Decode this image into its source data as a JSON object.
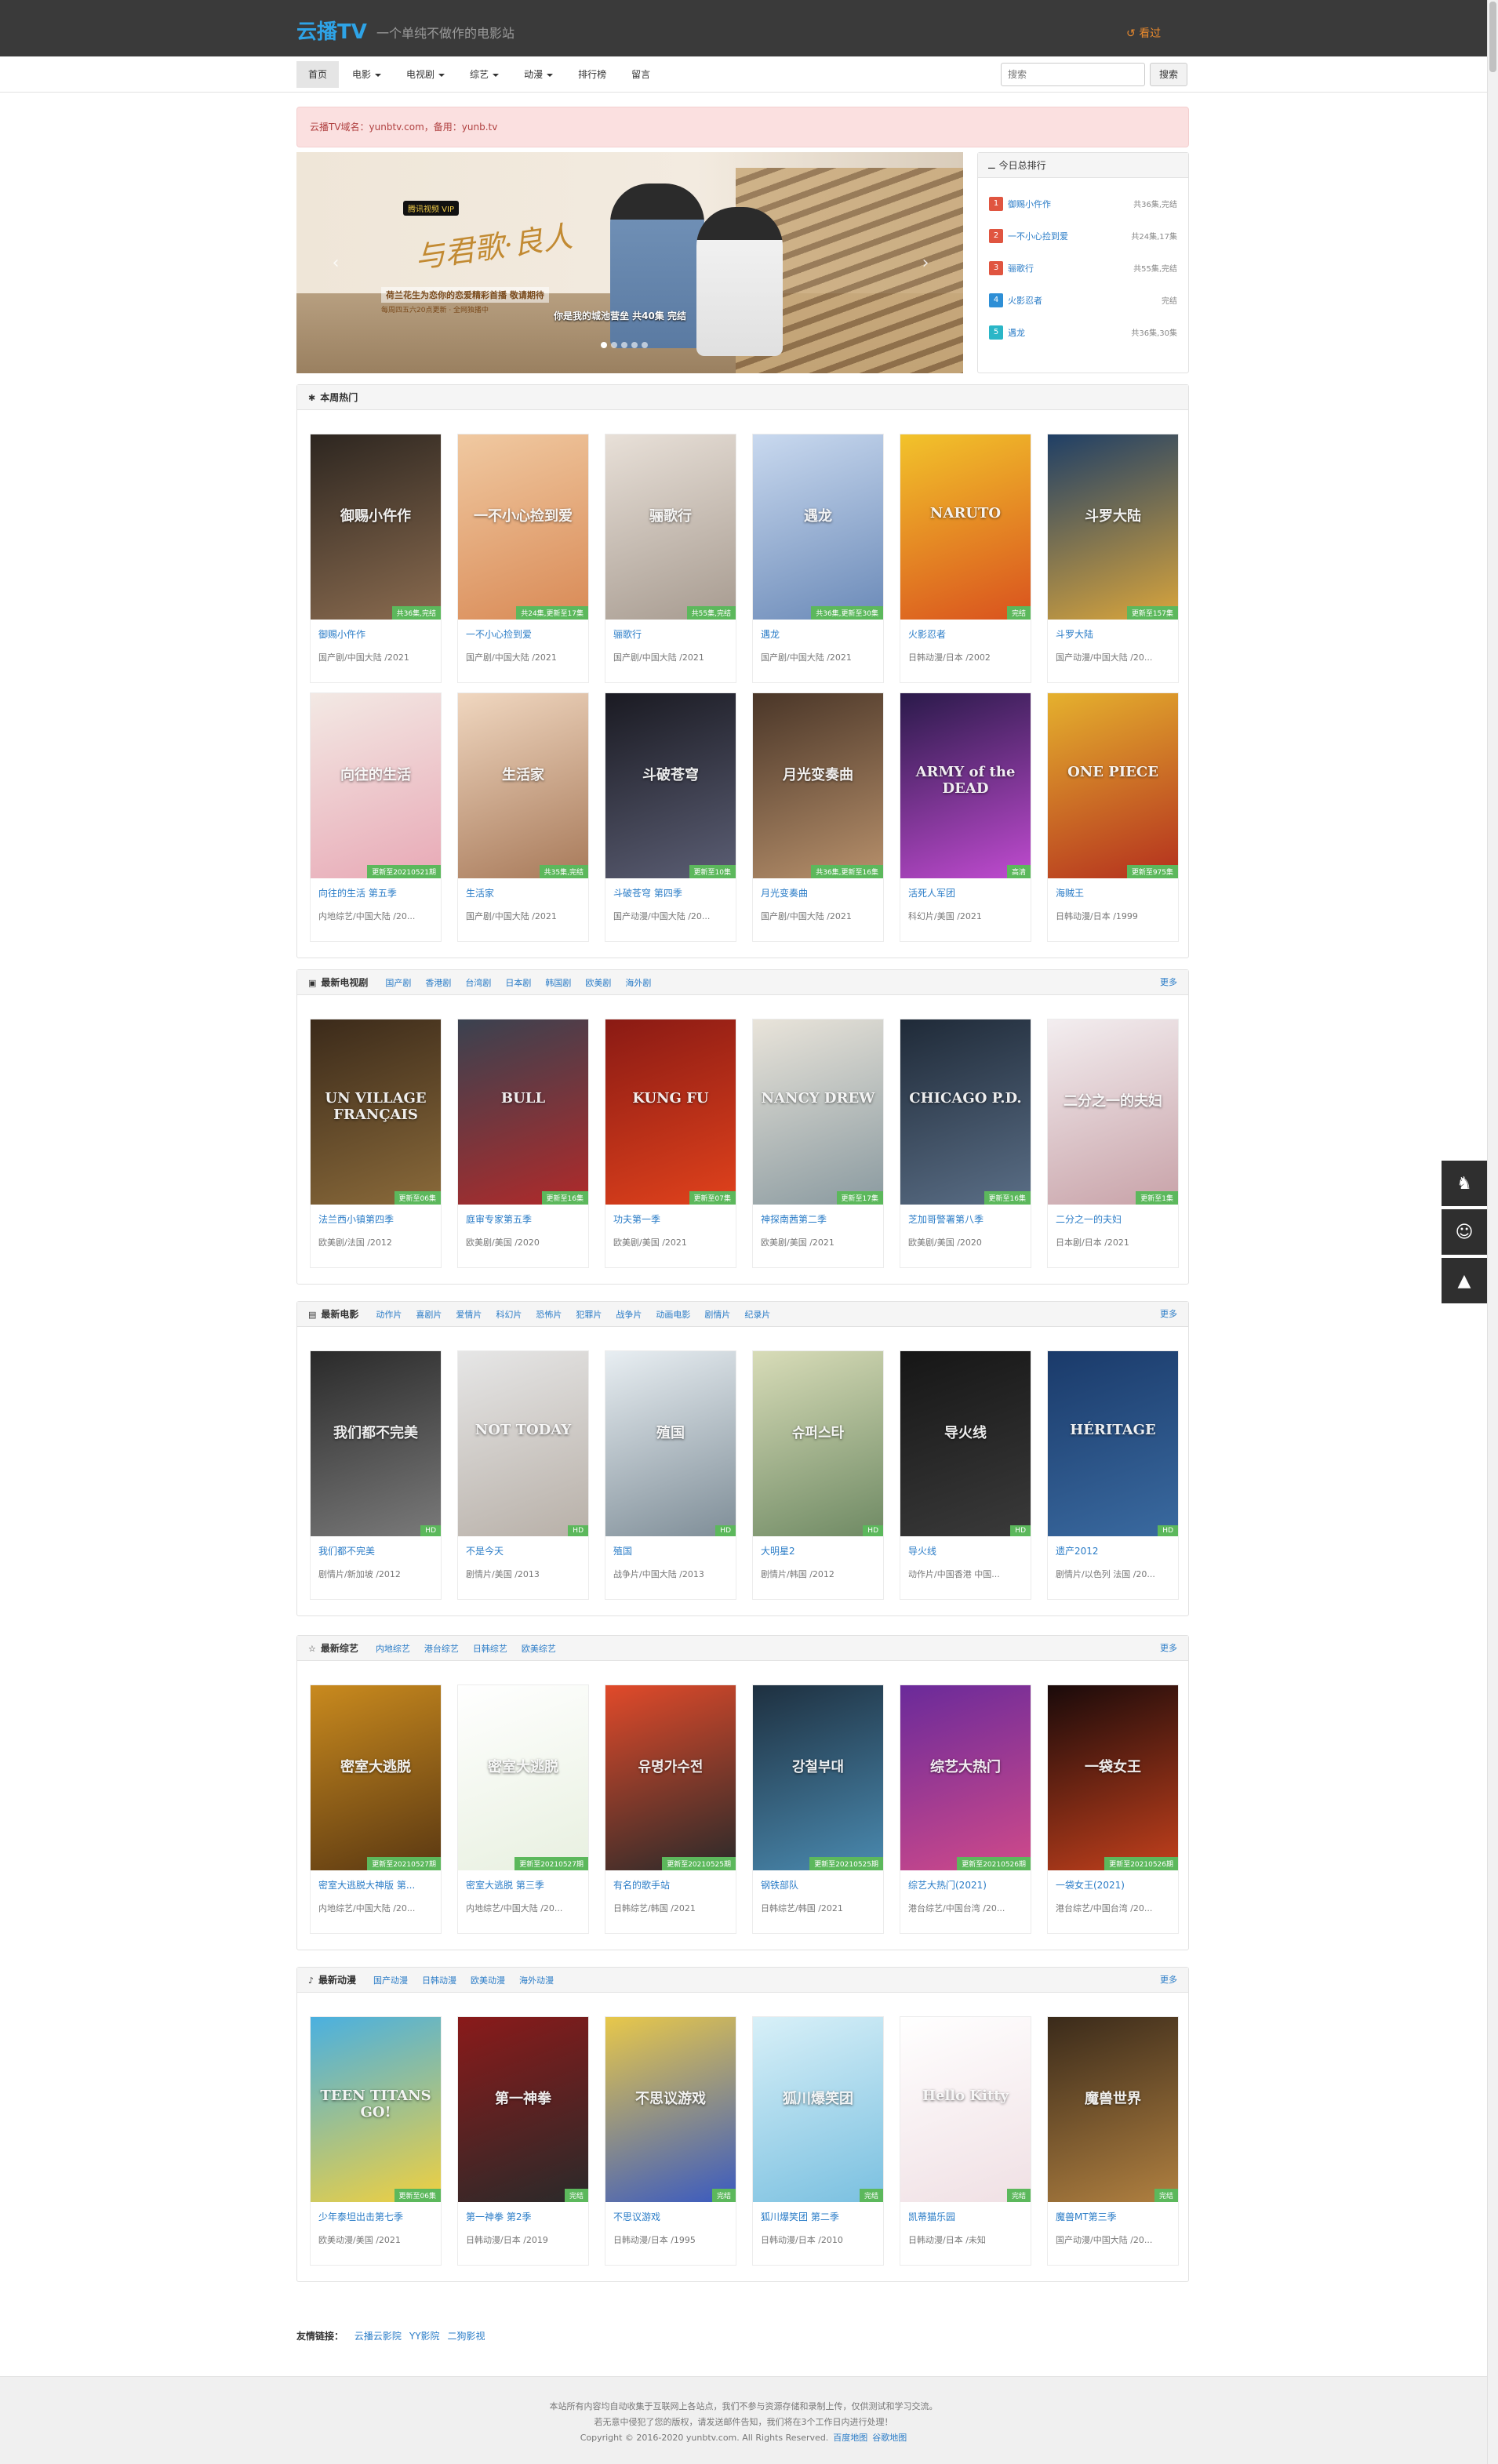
{
  "header": {
    "logo": "云播TV",
    "slogan": "一个单纯不做作的电影站",
    "history_label": "看过"
  },
  "nav": {
    "items": [
      {
        "label": "首页",
        "dropdown": false,
        "active": true
      },
      {
        "label": "电影",
        "dropdown": true,
        "active": false
      },
      {
        "label": "电视剧",
        "dropdown": true,
        "active": false
      },
      {
        "label": "综艺",
        "dropdown": true,
        "active": false
      },
      {
        "label": "动漫",
        "dropdown": true,
        "active": false
      },
      {
        "label": "排行榜",
        "dropdown": false,
        "active": false
      },
      {
        "label": "留言",
        "dropdown": false,
        "active": false
      }
    ],
    "search_placeholder": "搜索",
    "search_button": "搜索"
  },
  "notice": "云播TV域名：yunbtv.com，备用：yunb.tv",
  "banner": {
    "badge": "腾讯视频 VIP",
    "title": "与君歌·良人",
    "subtitle": "荷兰花生为恋你的恋爱精彩首播 敬请期待",
    "subtitle2": "每周四五六20点更新 · 全网独播中",
    "caption": "你是我的城池营垒 共40集 完结",
    "dots": 5,
    "active_dot": 0
  },
  "ranking": {
    "title": "今日总排行",
    "items": [
      {
        "num": "1",
        "title": "御赐小仵作",
        "status": "共36集,完结",
        "color": "#e05540"
      },
      {
        "num": "2",
        "title": "一不小心捡到爱",
        "status": "共24集,17集",
        "color": "#e05540"
      },
      {
        "num": "3",
        "title": "骊歌行",
        "status": "共55集,完结",
        "color": "#e05540"
      },
      {
        "num": "4",
        "title": "火影忍者",
        "status": "完结",
        "color": "#2e8fd6"
      },
      {
        "num": "5",
        "title": "遇龙",
        "status": "共36集,30集",
        "color": "#2ab6c7"
      }
    ]
  },
  "sections": [
    {
      "title": "本周热门",
      "icon": "pin-icon",
      "icon_glyph": "✱",
      "categories": [],
      "more": "",
      "items": [
        {
          "name": "御赐小仵作",
          "meta": "国产剧/中国大陆 /2021",
          "status": "共36集,完结",
          "c1": "#2d2620",
          "c2": "#8a6b4f",
          "poster_text": "御赐小仵作"
        },
        {
          "name": "一不小心捡到爱",
          "meta": "国产剧/中国大陆 /2021",
          "status": "共24集,更新至17集",
          "c1": "#f0c9a1",
          "c2": "#d98a56",
          "poster_text": "一不小心捡到爱"
        },
        {
          "name": "骊歌行",
          "meta": "国产剧/中国大陆 /2021",
          "status": "共55集,完结",
          "c1": "#e8e0d8",
          "c2": "#a79b90",
          "poster_text": "骊歌行"
        },
        {
          "name": "遇龙",
          "meta": "国产剧/中国大陆 /2021",
          "status": "共36集,更新至30集",
          "c1": "#c9d9ef",
          "c2": "#6b8ab8",
          "poster_text": "遇龙"
        },
        {
          "name": "火影忍者",
          "meta": "日韩动漫/日本 /2002",
          "status": "完结",
          "c1": "#f2c32b",
          "c2": "#d9521e",
          "poster_text": "NARUTO"
        },
        {
          "name": "斗罗大陆",
          "meta": "国产动漫/中国大陆 /20...",
          "status": "更新至157集",
          "c1": "#1f3f66",
          "c2": "#d9a53c",
          "poster_text": "斗罗大陆"
        },
        {
          "name": "向往的生活 第五季",
          "meta": "内地综艺/中国大陆 /20...",
          "status": "更新至20210521期",
          "c1": "#f3e9e4",
          "c2": "#e8a9b6",
          "poster_text": "向往的生活"
        },
        {
          "name": "生活家",
          "meta": "国产剧/中国大陆 /2021",
          "status": "共35集,完结",
          "c1": "#f0d7c0",
          "c2": "#a87a5a",
          "poster_text": "生活家"
        },
        {
          "name": "斗破苍穹 第四季",
          "meta": "国产动漫/中国大陆 /20...",
          "status": "更新至10集",
          "c1": "#1a1a22",
          "c2": "#5b5e74",
          "poster_text": "斗破苍穹"
        },
        {
          "name": "月光变奏曲",
          "meta": "国产剧/中国大陆 /2021",
          "status": "共36集,更新至16集",
          "c1": "#4a3628",
          "c2": "#b7906b",
          "poster_text": "月光变奏曲"
        },
        {
          "name": "活死人军团",
          "meta": "科幻片/美国 /2021",
          "status": "高清",
          "c1": "#2a1a4a",
          "c2": "#c04bd0",
          "poster_text": "ARMY of the DEAD"
        },
        {
          "name": "海贼王",
          "meta": "日韩动漫/日本 /1999",
          "status": "更新至975集",
          "c1": "#e5b12e",
          "c2": "#b4301e",
          "poster_text": "ONE PIECE"
        }
      ]
    },
    {
      "title": "最新电视剧",
      "icon": "tv-icon",
      "icon_glyph": "▣",
      "categories": [
        "国产剧",
        "香港剧",
        "台湾剧",
        "日本剧",
        "韩国剧",
        "欧美剧",
        "海外剧"
      ],
      "more": "更多",
      "items": [
        {
          "name": "法兰西小镇第四季",
          "meta": "欧美剧/法国 /2012",
          "status": "更新至06集",
          "c1": "#3b2a1a",
          "c2": "#8a6a3a",
          "poster_text": "UN VILLAGE FRANÇAIS"
        },
        {
          "name": "庭审专家第五季",
          "meta": "欧美剧/美国 /2020",
          "status": "更新至16集",
          "c1": "#3a4250",
          "c2": "#b02a2a",
          "poster_text": "BULL"
        },
        {
          "name": "功夫第一季",
          "meta": "欧美剧/美国 /2021",
          "status": "更新至07集",
          "c1": "#8a1a14",
          "c2": "#e0421c",
          "poster_text": "KUNG FU"
        },
        {
          "name": "神探南茜第二季",
          "meta": "欧美剧/美国 /2021",
          "status": "更新至17集",
          "c1": "#e9e4da",
          "c2": "#8a9aa0",
          "poster_text": "NANCY DREW"
        },
        {
          "name": "芝加哥警署第八季",
          "meta": "欧美剧/美国 /2020",
          "status": "更新至16集",
          "c1": "#1f2a38",
          "c2": "#5a6e86",
          "poster_text": "CHICAGO P.D."
        },
        {
          "name": "二分之一的夫妇",
          "meta": "日本剧/日本 /2021",
          "status": "更新至1集",
          "c1": "#f3eef0",
          "c2": "#c8a2a8",
          "poster_text": "二分之一的夫妇"
        }
      ]
    },
    {
      "title": "最新电影",
      "icon": "film-icon",
      "icon_glyph": "▤",
      "categories": [
        "动作片",
        "喜剧片",
        "爱情片",
        "科幻片",
        "恐怖片",
        "犯罪片",
        "战争片",
        "动画电影",
        "剧情片",
        "纪录片"
      ],
      "more": "更多",
      "items": [
        {
          "name": "我们都不完美",
          "meta": "剧情片/新加坡 /2012",
          "status": "HD",
          "c1": "#2a2a2a",
          "c2": "#7a7a7a",
          "poster_text": "我们都不完美"
        },
        {
          "name": "不是今天",
          "meta": "剧情片/美国 /2013",
          "status": "HD",
          "c1": "#e6e6e6",
          "c2": "#b8b0a8",
          "poster_text": "NOT TODAY"
        },
        {
          "name": "殖国",
          "meta": "战争片/中国大陆 /2013",
          "status": "HD",
          "c1": "#e8eef2",
          "c2": "#7f8e98",
          "poster_text": "殖国"
        },
        {
          "name": "大明星2",
          "meta": "剧情片/韩国 /2012",
          "status": "HD",
          "c1": "#d8dcb8",
          "c2": "#6f8a64",
          "poster_text": "슈퍼스타"
        },
        {
          "name": "导火线",
          "meta": "动作片/中国香港 中国...",
          "status": "HD",
          "c1": "#161616",
          "c2": "#3a3a3a",
          "poster_text": "导火线"
        },
        {
          "name": "遗产2012",
          "meta": "剧情片/以色列 法国 /20...",
          "status": "HD",
          "c1": "#1a3a6a",
          "c2": "#3a6aa0",
          "poster_text": "HÉRITAGE"
        }
      ]
    },
    {
      "title": "最新综艺",
      "icon": "star-icon",
      "icon_glyph": "☆",
      "categories": [
        "内地综艺",
        "港台综艺",
        "日韩综艺",
        "欧美综艺"
      ],
      "more": "更多",
      "items": [
        {
          "name": "密室大逃脱大神版 第...",
          "meta": "内地综艺/中国大陆 /20...",
          "status": "更新至20210527期",
          "c1": "#c98a1e",
          "c2": "#5a3812",
          "poster_text": "密室大逃脱"
        },
        {
          "name": "密室大逃脱 第三季",
          "meta": "内地综艺/中国大陆 /20...",
          "status": "更新至20210527期",
          "c1": "#ffffff",
          "c2": "#e8f0e0",
          "poster_text": "密室大逃脱"
        },
        {
          "name": "有名的歌手站",
          "meta": "日韩综艺/韩国 /2021",
          "status": "更新至20210525期",
          "c1": "#e14a2a",
          "c2": "#2a2a2a",
          "poster_text": "유명가수전"
        },
        {
          "name": "钢铁部队",
          "meta": "日韩综艺/韩国 /2021",
          "status": "更新至20210525期",
          "c1": "#1e3040",
          "c2": "#4a8ab0",
          "poster_text": "강철부대"
        },
        {
          "name": "综艺大热门(2021)",
          "meta": "港台综艺/中国台湾 /20...",
          "status": "更新至20210526期",
          "c1": "#6a2a9a",
          "c2": "#d04a8a",
          "poster_text": "综艺大热门"
        },
        {
          "name": "一袋女王(2021)",
          "meta": "港台综艺/中国台湾 /20...",
          "status": "更新至20210526期",
          "c1": "#1a0a0a",
          "c2": "#c2401c",
          "poster_text": "一袋女王"
        }
      ]
    },
    {
      "title": "最新动漫",
      "icon": "bell-icon",
      "icon_glyph": "♪",
      "categories": [
        "国产动漫",
        "日韩动漫",
        "欧美动漫",
        "海外动漫"
      ],
      "more": "更多",
      "items": [
        {
          "name": "少年泰坦出击第七季",
          "meta": "欧美动漫/美国 /2021",
          "status": "更新至06集",
          "c1": "#4ab0e0",
          "c2": "#f0d040",
          "poster_text": "TEEN TITANS GO!"
        },
        {
          "name": "第一神拳 第2季",
          "meta": "日韩动漫/日本 /2019",
          "status": "完结",
          "c1": "#8a1a1a",
          "c2": "#2a2a2a",
          "poster_text": "第一神拳"
        },
        {
          "name": "不思议游戏",
          "meta": "日韩动漫/日本 /1995",
          "status": "完结",
          "c1": "#e8c84a",
          "c2": "#3a5ac0",
          "poster_text": "不思议游戏"
        },
        {
          "name": "狐川爆笑团 第二季",
          "meta": "日韩动漫/日本 /2010",
          "status": "完结",
          "c1": "#d8f0f8",
          "c2": "#7ac0e0",
          "poster_text": "狐川爆笑团"
        },
        {
          "name": "凯蒂猫乐园",
          "meta": "日韩动漫/日本 /未知",
          "status": "完结",
          "c1": "#ffffff",
          "c2": "#f0e0e4",
          "poster_text": "Hello Kitty"
        },
        {
          "name": "魔兽MT第三季",
          "meta": "国产动漫/中国大陆 /20...",
          "status": "完结",
          "c1": "#3a2a1a",
          "c2": "#b08040",
          "poster_text": "魔兽世界"
        }
      ]
    }
  ],
  "friend_links": {
    "label": "友情链接：",
    "links": [
      "云播云影院",
      "YY影院",
      "二狗影视"
    ]
  },
  "footer": {
    "line1": "本站所有内容均自动收集于互联网上各站点，我们不参与资源存储和录制上传，仅供测试和学习交流。",
    "line2": "若无意中侵犯了您的版权，请发送邮件告知，我们将在3个工作日内进行处理！",
    "copyright": "Copyright © 2016-2020 yunbtv.com. All Rights Reserved.",
    "links": [
      "百度地图",
      "谷歌地图"
    ]
  },
  "float_tools": {
    "icons": [
      "qq-icon",
      "wechat-icon",
      "arrow-up-icon"
    ]
  },
  "colors": {
    "accent": "#2a7cc7",
    "logo": "#2ea3e6",
    "header_bg": "#3a3a3a",
    "status_green": "#5cb85c"
  }
}
